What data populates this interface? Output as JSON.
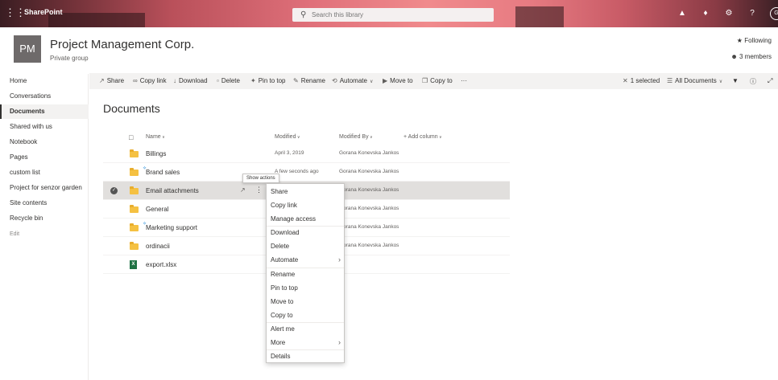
{
  "suite": {
    "app_name": "SharePoint",
    "search_placeholder": "Search this library",
    "user_initials": "G"
  },
  "site": {
    "logo_initials": "PM",
    "title": "Project Management Corp.",
    "subtitle": "Private group",
    "following": "Following",
    "members": "3 members"
  },
  "nav": {
    "items": [
      "Home",
      "Conversations",
      "Documents",
      "Shared with us",
      "Notebook",
      "Pages",
      "custom list",
      "Project for senzor garden",
      "Site contents",
      "Recycle bin"
    ],
    "edit": "Edit"
  },
  "commands": {
    "share": "Share",
    "copy_link": "Copy link",
    "download": "Download",
    "delete": "Delete",
    "pin_to_top": "Pin to top",
    "rename": "Rename",
    "automate": "Automate",
    "move_to": "Move to",
    "copy_to": "Copy to",
    "more": "···",
    "selected": "1 selected",
    "view": "All Documents"
  },
  "library": {
    "title": "Documents",
    "columns": {
      "name": "Name",
      "modified": "Modified",
      "modified_by": "Modified By",
      "add_column": "Add column"
    },
    "rows": [
      {
        "name": "Billings",
        "modified": "April 3, 2019",
        "by": "Gorana Konevska Jankoski"
      },
      {
        "name": "Brand sales",
        "modified": "A few seconds ago",
        "by": "Gorana Konevska Jankoski"
      },
      {
        "name": "Email attachments",
        "modified": "",
        "by": "Gorana Konevska Jankoski"
      },
      {
        "name": "General",
        "modified": "",
        "by": "Gorana Konevska Jankoski"
      },
      {
        "name": "Marketing support",
        "modified": "",
        "by": "Gorana Konevska Jankoski"
      },
      {
        "name": "ordinacii",
        "modified": "",
        "by": "Gorana Konevska Jankoski"
      },
      {
        "name": "export.xlsx",
        "modified": "",
        "by": ""
      }
    ]
  },
  "tooltip": "Show actions",
  "context_menu": {
    "share": "Share",
    "copy_link": "Copy link",
    "manage_access": "Manage access",
    "download": "Download",
    "delete": "Delete",
    "automate": "Automate",
    "rename": "Rename",
    "pin_to_top": "Pin to top",
    "move_to": "Move to",
    "copy_to": "Copy to",
    "alert_me": "Alert me",
    "more": "More",
    "details": "Details"
  }
}
